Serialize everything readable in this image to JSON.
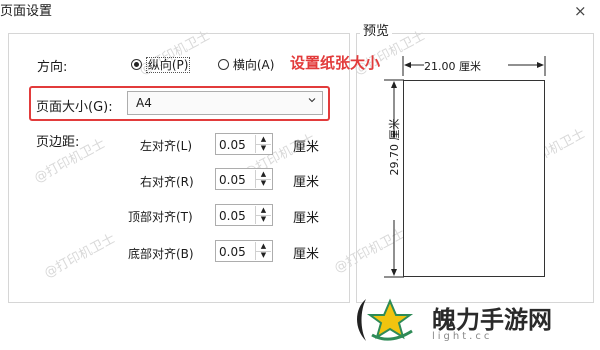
{
  "dialog": {
    "title": "页面设置",
    "close_glyph": "×"
  },
  "orientation": {
    "label": "方向:",
    "options": [
      {
        "label": "纵向(P)",
        "selected": true
      },
      {
        "label": "横向(A)",
        "selected": false
      }
    ]
  },
  "annotation": "设置纸张大小",
  "page_size": {
    "label": "页面大小(G):",
    "value": "A4"
  },
  "margins": {
    "label": "页边距:",
    "unit": "厘米",
    "rows": [
      {
        "label": "左对齐(L)",
        "value": "0.05"
      },
      {
        "label": "右对齐(R)",
        "value": "0.05"
      },
      {
        "label": "顶部对齐(T)",
        "value": "0.05"
      },
      {
        "label": "底部对齐(B)",
        "value": "0.05"
      }
    ]
  },
  "preview": {
    "label": "预览",
    "width_label": "21.00 厘米",
    "height_label": "29.70 厘米"
  },
  "watermark": "@打印机卫士",
  "logo": {
    "text": "魄力手游网",
    "sub": "light.cc"
  },
  "colors": {
    "annotation": "#e23b3b",
    "border": "#d6d6d6"
  }
}
